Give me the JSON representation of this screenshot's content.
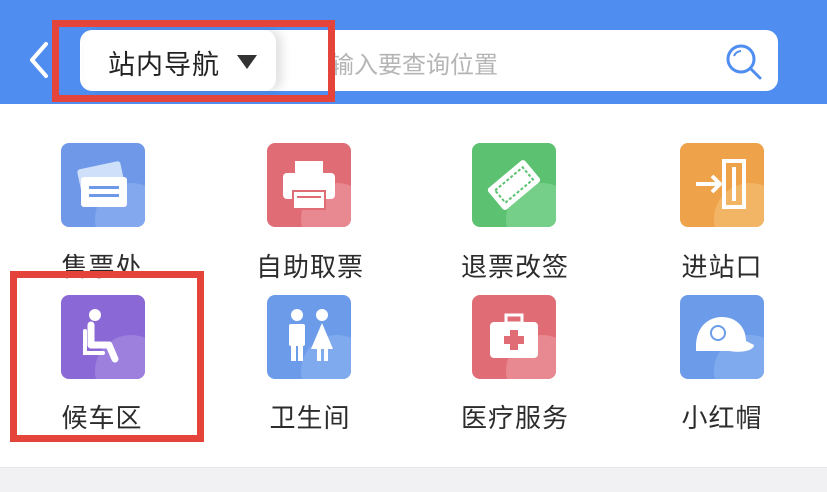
{
  "header": {
    "dropdown_label": "站内导航",
    "search_placeholder": "输入要查询位置"
  },
  "grid": [
    {
      "label": "售票处",
      "icon": "ticket-office-icon",
      "color": "#6f98e8"
    },
    {
      "label": "自助取票",
      "icon": "printer-icon",
      "color": "#e06d76"
    },
    {
      "label": "退票改签",
      "icon": "refund-ticket-icon",
      "color": "#5cc170"
    },
    {
      "label": "进站口",
      "icon": "entrance-icon",
      "color": "#eea24a"
    },
    {
      "label": "候车区",
      "icon": "waiting-seat-icon",
      "color": "#8a68d6"
    },
    {
      "label": "卫生间",
      "icon": "restroom-icon",
      "color": "#6c9ce9"
    },
    {
      "label": "医疗服务",
      "icon": "medical-kit-icon",
      "color": "#e06d76"
    },
    {
      "label": "小红帽",
      "icon": "red-cap-icon",
      "color": "#6c9ce9"
    }
  ]
}
